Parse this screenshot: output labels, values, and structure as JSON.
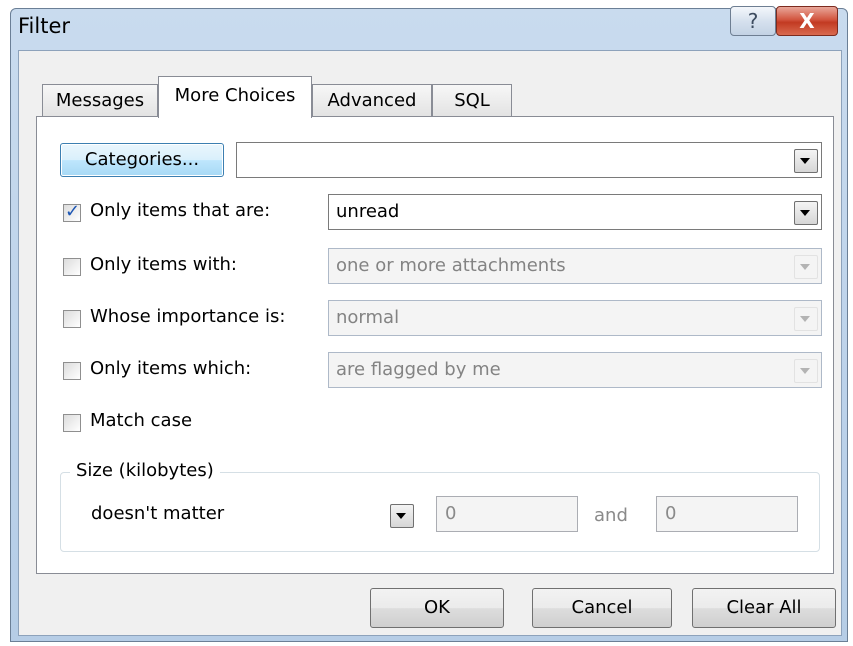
{
  "window": {
    "title": "Filter",
    "help_glyph": "?",
    "close_glyph": "X"
  },
  "tabs": [
    {
      "label": "Messages"
    },
    {
      "label": "More Choices"
    },
    {
      "label": "Advanced"
    },
    {
      "label": "SQL"
    }
  ],
  "categories": {
    "button_label": "Categories...",
    "value": ""
  },
  "rows": [
    {
      "label": "Only items that are:",
      "checked": true,
      "value": "unread",
      "enabled": true
    },
    {
      "label": "Only items with:",
      "checked": false,
      "value": "one or more attachments",
      "enabled": false
    },
    {
      "label": "Whose importance is:",
      "checked": false,
      "value": "normal",
      "enabled": false
    },
    {
      "label": "Only items which:",
      "checked": false,
      "value": "are flagged by me",
      "enabled": false
    }
  ],
  "match_case": {
    "label": "Match case",
    "checked": false
  },
  "size": {
    "group_label": "Size (kilobytes)",
    "mode": "doesn't matter",
    "min": "0",
    "and_label": "and",
    "max": "0"
  },
  "footer": {
    "ok_label": "OK",
    "cancel_label": "Cancel",
    "clear_label": "Clear All"
  }
}
